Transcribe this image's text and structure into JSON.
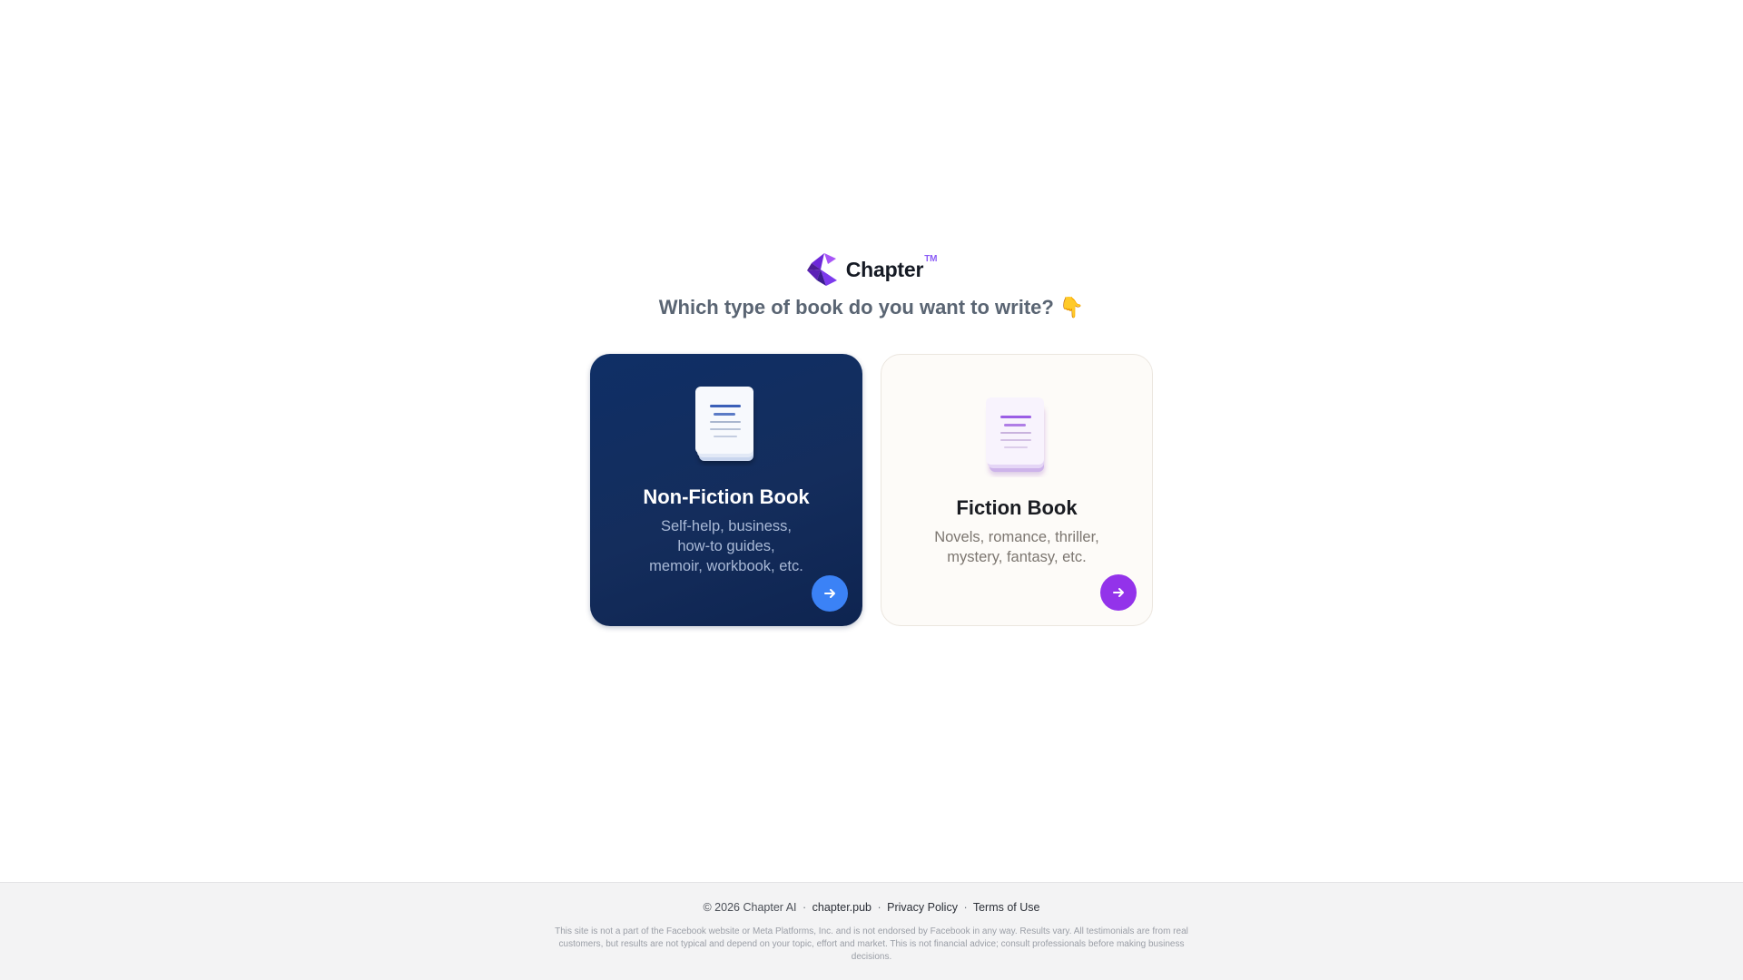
{
  "brand": {
    "name": "Chapter",
    "trademark": "TM",
    "logo_colors": [
      "#3b1d8f",
      "#7c3aed",
      "#a855f7"
    ]
  },
  "question": {
    "text": "Which type of book do you want to write?",
    "emoji": "👇"
  },
  "cards": [
    {
      "id": "non-fiction",
      "title": "Non-Fiction Book",
      "description_lines": [
        "Self-help, business,",
        "how-to guides,",
        "memoir, workbook, etc."
      ],
      "background": "#0f2f66",
      "button_color": "#3b82f6",
      "icon": "document-stack-icon",
      "selected": true
    },
    {
      "id": "fiction",
      "title": "Fiction Book",
      "description_lines": [
        "Novels, romance, thriller,",
        "mystery, fantasy, etc."
      ],
      "background": "#fdfbf8",
      "button_color": "#9333ea",
      "icon": "document-stack-icon",
      "selected": false
    }
  ],
  "footer": {
    "copyright": "© 2026 Chapter AI",
    "separator": "·",
    "links": [
      "chapter.pub",
      "Privacy Policy",
      "Terms of Use"
    ],
    "disclaimer": "This site is not a part of the Facebook website or Meta Platforms, Inc. and is not endorsed by Facebook in any way. Results vary. All testimonials are from real customers, but results are not typical and depend on your topic, effort and market. This is not financial advice; consult professionals before making business decisions."
  }
}
